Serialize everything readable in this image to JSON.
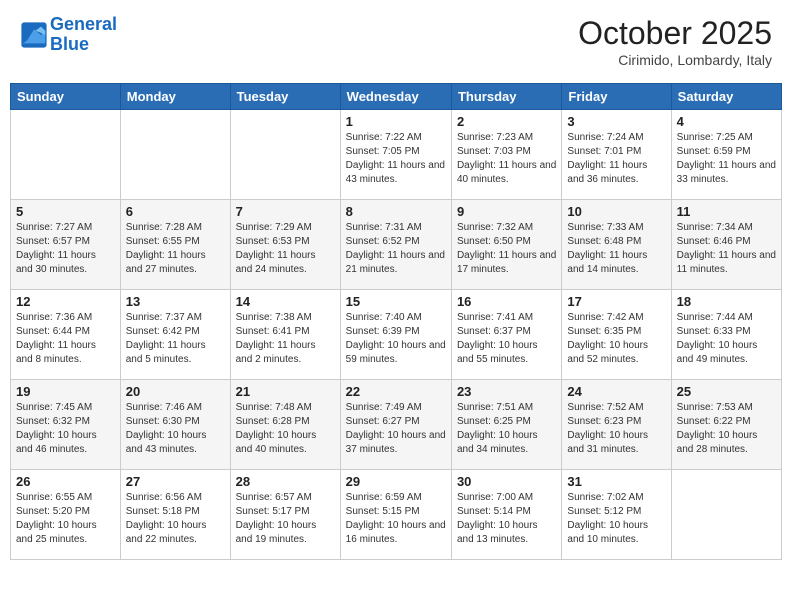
{
  "logo": {
    "line1": "General",
    "line2": "Blue"
  },
  "title": "October 2025",
  "location": "Cirimido, Lombardy, Italy",
  "days_of_week": [
    "Sunday",
    "Monday",
    "Tuesday",
    "Wednesday",
    "Thursday",
    "Friday",
    "Saturday"
  ],
  "weeks": [
    [
      {
        "day": "",
        "sunrise": "",
        "sunset": "",
        "daylight": ""
      },
      {
        "day": "",
        "sunrise": "",
        "sunset": "",
        "daylight": ""
      },
      {
        "day": "",
        "sunrise": "",
        "sunset": "",
        "daylight": ""
      },
      {
        "day": "1",
        "sunrise": "Sunrise: 7:22 AM",
        "sunset": "Sunset: 7:05 PM",
        "daylight": "Daylight: 11 hours and 43 minutes."
      },
      {
        "day": "2",
        "sunrise": "Sunrise: 7:23 AM",
        "sunset": "Sunset: 7:03 PM",
        "daylight": "Daylight: 11 hours and 40 minutes."
      },
      {
        "day": "3",
        "sunrise": "Sunrise: 7:24 AM",
        "sunset": "Sunset: 7:01 PM",
        "daylight": "Daylight: 11 hours and 36 minutes."
      },
      {
        "day": "4",
        "sunrise": "Sunrise: 7:25 AM",
        "sunset": "Sunset: 6:59 PM",
        "daylight": "Daylight: 11 hours and 33 minutes."
      }
    ],
    [
      {
        "day": "5",
        "sunrise": "Sunrise: 7:27 AM",
        "sunset": "Sunset: 6:57 PM",
        "daylight": "Daylight: 11 hours and 30 minutes."
      },
      {
        "day": "6",
        "sunrise": "Sunrise: 7:28 AM",
        "sunset": "Sunset: 6:55 PM",
        "daylight": "Daylight: 11 hours and 27 minutes."
      },
      {
        "day": "7",
        "sunrise": "Sunrise: 7:29 AM",
        "sunset": "Sunset: 6:53 PM",
        "daylight": "Daylight: 11 hours and 24 minutes."
      },
      {
        "day": "8",
        "sunrise": "Sunrise: 7:31 AM",
        "sunset": "Sunset: 6:52 PM",
        "daylight": "Daylight: 11 hours and 21 minutes."
      },
      {
        "day": "9",
        "sunrise": "Sunrise: 7:32 AM",
        "sunset": "Sunset: 6:50 PM",
        "daylight": "Daylight: 11 hours and 17 minutes."
      },
      {
        "day": "10",
        "sunrise": "Sunrise: 7:33 AM",
        "sunset": "Sunset: 6:48 PM",
        "daylight": "Daylight: 11 hours and 14 minutes."
      },
      {
        "day": "11",
        "sunrise": "Sunrise: 7:34 AM",
        "sunset": "Sunset: 6:46 PM",
        "daylight": "Daylight: 11 hours and 11 minutes."
      }
    ],
    [
      {
        "day": "12",
        "sunrise": "Sunrise: 7:36 AM",
        "sunset": "Sunset: 6:44 PM",
        "daylight": "Daylight: 11 hours and 8 minutes."
      },
      {
        "day": "13",
        "sunrise": "Sunrise: 7:37 AM",
        "sunset": "Sunset: 6:42 PM",
        "daylight": "Daylight: 11 hours and 5 minutes."
      },
      {
        "day": "14",
        "sunrise": "Sunrise: 7:38 AM",
        "sunset": "Sunset: 6:41 PM",
        "daylight": "Daylight: 11 hours and 2 minutes."
      },
      {
        "day": "15",
        "sunrise": "Sunrise: 7:40 AM",
        "sunset": "Sunset: 6:39 PM",
        "daylight": "Daylight: 10 hours and 59 minutes."
      },
      {
        "day": "16",
        "sunrise": "Sunrise: 7:41 AM",
        "sunset": "Sunset: 6:37 PM",
        "daylight": "Daylight: 10 hours and 55 minutes."
      },
      {
        "day": "17",
        "sunrise": "Sunrise: 7:42 AM",
        "sunset": "Sunset: 6:35 PM",
        "daylight": "Daylight: 10 hours and 52 minutes."
      },
      {
        "day": "18",
        "sunrise": "Sunrise: 7:44 AM",
        "sunset": "Sunset: 6:33 PM",
        "daylight": "Daylight: 10 hours and 49 minutes."
      }
    ],
    [
      {
        "day": "19",
        "sunrise": "Sunrise: 7:45 AM",
        "sunset": "Sunset: 6:32 PM",
        "daylight": "Daylight: 10 hours and 46 minutes."
      },
      {
        "day": "20",
        "sunrise": "Sunrise: 7:46 AM",
        "sunset": "Sunset: 6:30 PM",
        "daylight": "Daylight: 10 hours and 43 minutes."
      },
      {
        "day": "21",
        "sunrise": "Sunrise: 7:48 AM",
        "sunset": "Sunset: 6:28 PM",
        "daylight": "Daylight: 10 hours and 40 minutes."
      },
      {
        "day": "22",
        "sunrise": "Sunrise: 7:49 AM",
        "sunset": "Sunset: 6:27 PM",
        "daylight": "Daylight: 10 hours and 37 minutes."
      },
      {
        "day": "23",
        "sunrise": "Sunrise: 7:51 AM",
        "sunset": "Sunset: 6:25 PM",
        "daylight": "Daylight: 10 hours and 34 minutes."
      },
      {
        "day": "24",
        "sunrise": "Sunrise: 7:52 AM",
        "sunset": "Sunset: 6:23 PM",
        "daylight": "Daylight: 10 hours and 31 minutes."
      },
      {
        "day": "25",
        "sunrise": "Sunrise: 7:53 AM",
        "sunset": "Sunset: 6:22 PM",
        "daylight": "Daylight: 10 hours and 28 minutes."
      }
    ],
    [
      {
        "day": "26",
        "sunrise": "Sunrise: 6:55 AM",
        "sunset": "Sunset: 5:20 PM",
        "daylight": "Daylight: 10 hours and 25 minutes."
      },
      {
        "day": "27",
        "sunrise": "Sunrise: 6:56 AM",
        "sunset": "Sunset: 5:18 PM",
        "daylight": "Daylight: 10 hours and 22 minutes."
      },
      {
        "day": "28",
        "sunrise": "Sunrise: 6:57 AM",
        "sunset": "Sunset: 5:17 PM",
        "daylight": "Daylight: 10 hours and 19 minutes."
      },
      {
        "day": "29",
        "sunrise": "Sunrise: 6:59 AM",
        "sunset": "Sunset: 5:15 PM",
        "daylight": "Daylight: 10 hours and 16 minutes."
      },
      {
        "day": "30",
        "sunrise": "Sunrise: 7:00 AM",
        "sunset": "Sunset: 5:14 PM",
        "daylight": "Daylight: 10 hours and 13 minutes."
      },
      {
        "day": "31",
        "sunrise": "Sunrise: 7:02 AM",
        "sunset": "Sunset: 5:12 PM",
        "daylight": "Daylight: 10 hours and 10 minutes."
      },
      {
        "day": "",
        "sunrise": "",
        "sunset": "",
        "daylight": ""
      }
    ]
  ]
}
